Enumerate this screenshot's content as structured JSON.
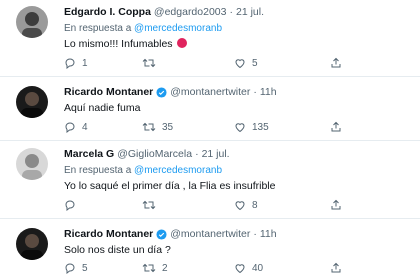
{
  "tweets": [
    {
      "name": "Edgardo I. Coppa",
      "handle": "@edgardo2003",
      "separator": "·",
      "time": "21 jul.",
      "reply_prefix": "En respuesta a",
      "reply_to": "@mercedesmoranb",
      "text": "Lo mismo!!! Infumables",
      "emoji": "angry-face-emoji",
      "replies": "1",
      "retweets": "",
      "likes": "5"
    },
    {
      "name": "Ricardo Montaner",
      "verified": true,
      "handle": "@montanertwiter",
      "separator": "·",
      "time": "11h",
      "text": "Aquí nadie fuma",
      "replies": "4",
      "retweets": "35",
      "likes": "135"
    },
    {
      "name": "Marcela G",
      "handle": "@GiglioMarcela",
      "separator": "·",
      "time": "21 jul.",
      "reply_prefix": "En respuesta a",
      "reply_to": "@mercedesmoranb",
      "text": "Yo lo saqué el primer día , la Flia es insufrible",
      "replies": "",
      "retweets": "",
      "likes": "8"
    },
    {
      "name": "Ricardo Montaner",
      "verified": true,
      "handle": "@montanertwiter",
      "separator": "·",
      "time": "11h",
      "text": "Solo nos diste un día ?",
      "replies": "5",
      "retweets": "2",
      "likes": "40"
    }
  ],
  "colors": {
    "accent": "#1d9bf0",
    "muted": "#536471",
    "divider": "#e6ecf0",
    "emoji": "#e0245e"
  }
}
